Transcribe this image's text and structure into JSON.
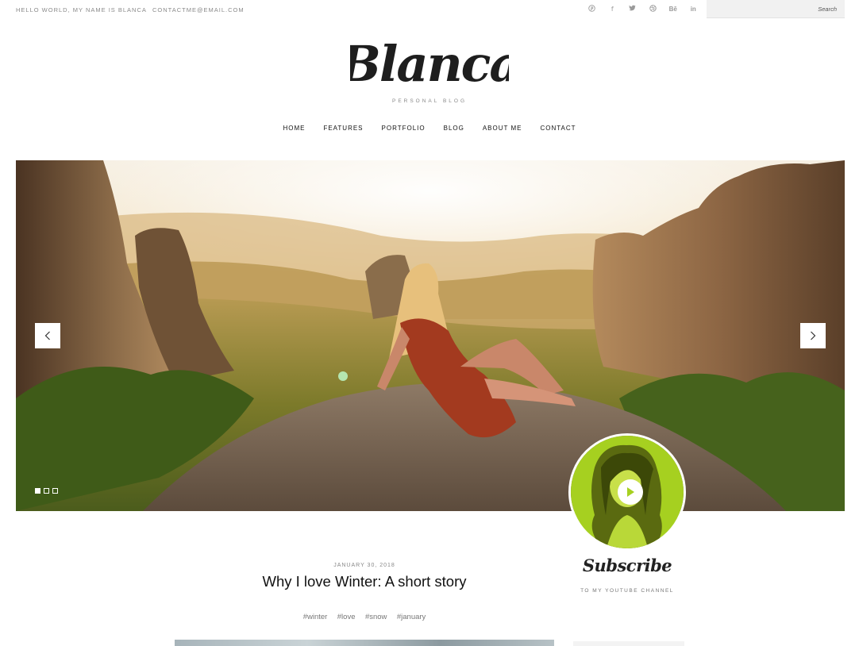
{
  "topbar": {
    "greeting": "HELLO WORLD, MY NAME IS BLANCA",
    "email": "CONTACTME@EMAIL.COM",
    "social": [
      {
        "icon": "pinterest-icon",
        "glyph": "℗"
      },
      {
        "icon": "facebook-icon",
        "glyph": "f"
      },
      {
        "icon": "twitter-icon",
        "glyph": "🐦"
      },
      {
        "icon": "dribbble-icon",
        "glyph": "◎"
      },
      {
        "icon": "behance-icon",
        "glyph": "Bē"
      },
      {
        "icon": "linkedin-icon",
        "glyph": "in"
      }
    ],
    "search_placeholder": "Search"
  },
  "logo": {
    "name": "Blanca",
    "tagline": "PERSONAL BLOG"
  },
  "nav": {
    "items": [
      "HOME",
      "FEATURES",
      "PORTFOLIO",
      "BLOG",
      "ABOUT ME",
      "CONTACT"
    ]
  },
  "slider": {
    "slide_count": 3,
    "active_slide": 1
  },
  "video_widget": {
    "title": "Subscribe",
    "subtitle": "TO MY YOUTUBE CHANNEL"
  },
  "post": {
    "date": "JANUARY 30, 2018",
    "title": "Why I love Winter: A short story",
    "tags": [
      "#winter",
      "#love",
      "#snow",
      "#january"
    ]
  },
  "colors": {
    "accent_green": "#a6d020",
    "text_dark": "#111111",
    "text_muted": "#888888"
  }
}
